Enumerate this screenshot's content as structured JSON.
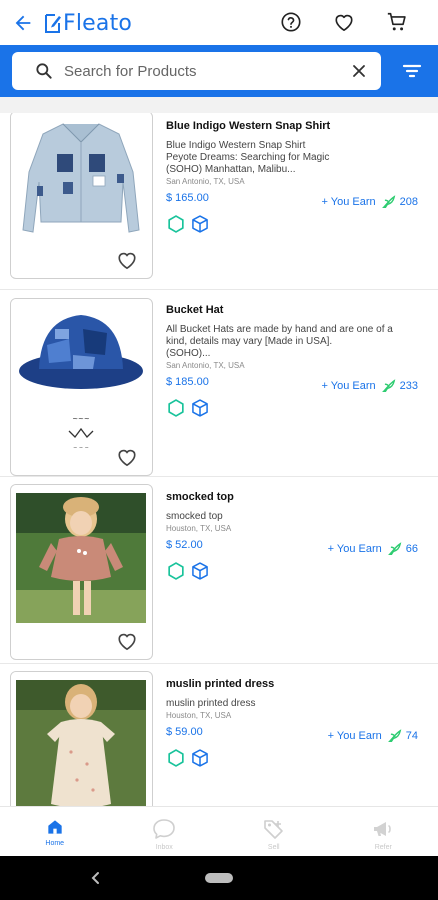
{
  "header": {
    "logo_text": "Fleato",
    "icons": [
      "back-arrow-icon",
      "help-icon",
      "heart-icon",
      "cart-icon"
    ]
  },
  "search": {
    "placeholder": "Search for Products",
    "value": ""
  },
  "products": [
    {
      "title": "Blue Indigo Western Snap Shirt",
      "description": "Blue Indigo Western Snap Shirt\nPeyote Dreams: Searching for Magic\n(SOHO) Manhattan, Malibu...",
      "location": "San Antonio, TX, USA",
      "price": "$ 165.00",
      "earn_label": "+ You Earn",
      "earn_points": "208"
    },
    {
      "title": "Bucket Hat",
      "description": "All Bucket Hats are made by hand and are one of a kind, details may vary [Made in USA].\n(SOHO)...",
      "location": "San Antonio, TX, USA",
      "price": "$ 185.00",
      "earn_label": "+ You Earn",
      "earn_points": "233"
    },
    {
      "title": "smocked top",
      "description": "smocked top",
      "location": "Houston, TX, USA",
      "price": "$ 52.00",
      "earn_label": "+ You Earn",
      "earn_points": "66"
    },
    {
      "title": "muslin printed dress",
      "description": "muslin printed dress",
      "location": "Houston, TX, USA",
      "price": "$ 59.00",
      "earn_label": "+ You Earn",
      "earn_points": "74"
    }
  ],
  "bottom_nav": [
    {
      "label": "Home",
      "icon": "home-icon",
      "active": true
    },
    {
      "label": "Inbox",
      "icon": "chat-icon",
      "active": false
    },
    {
      "label": "Sell",
      "icon": "tag-icon",
      "active": false
    },
    {
      "label": "Refer",
      "icon": "megaphone-icon",
      "active": false
    }
  ],
  "colors": {
    "brand_blue": "#1a73e8",
    "badge_green": "#19c39b",
    "earn_green": "#2ecc71"
  }
}
